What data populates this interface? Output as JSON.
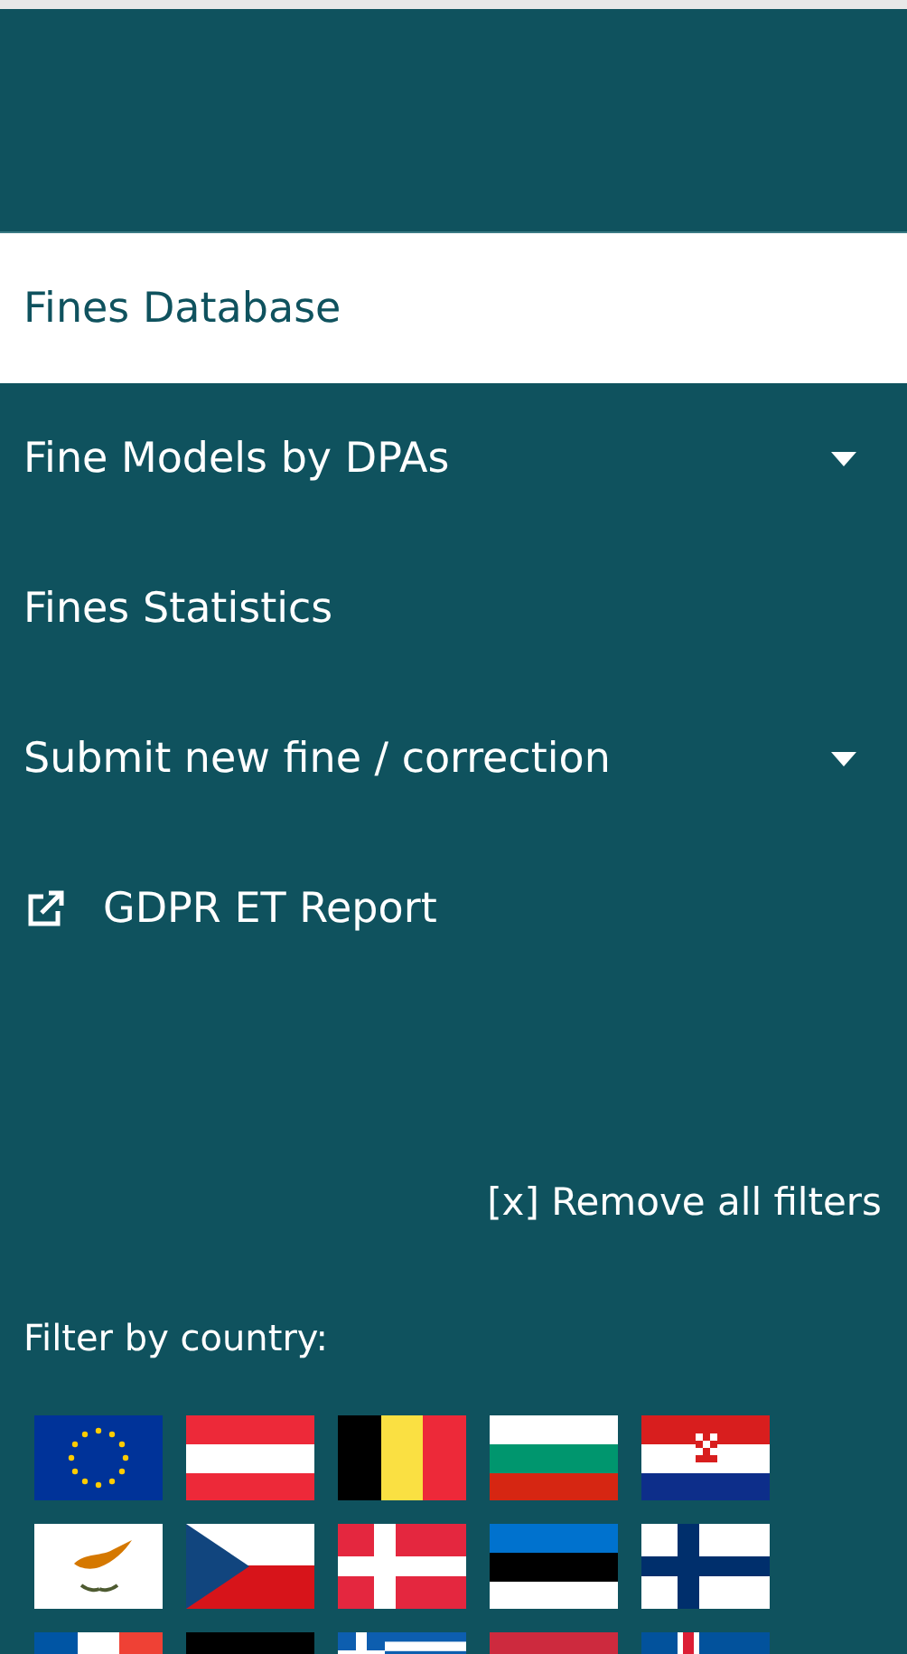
{
  "menu": [
    {
      "label": "Fines Database",
      "selected": true,
      "expandable": false,
      "external": false
    },
    {
      "label": "Fine Models by DPAs",
      "selected": false,
      "expandable": true,
      "external": false
    },
    {
      "label": "Fines Statistics",
      "selected": false,
      "expandable": false,
      "external": false
    },
    {
      "label": "Submit new fine / correction",
      "selected": false,
      "expandable": true,
      "external": false
    },
    {
      "label": "GDPR ET Report",
      "selected": false,
      "expandable": false,
      "external": true
    }
  ],
  "remove_filters": "[x] Remove all filters",
  "country_filter": {
    "label": "Filter by country:",
    "flags": [
      {
        "kind": "eu"
      },
      {
        "kind": "at"
      },
      {
        "kind": "be"
      },
      {
        "kind": "bg"
      },
      {
        "kind": "hr"
      },
      {
        "kind": "cy"
      },
      {
        "kind": "cz"
      },
      {
        "kind": "dk"
      },
      {
        "kind": "ee"
      },
      {
        "kind": "fi"
      },
      {
        "kind": "fr"
      },
      {
        "kind": "de"
      },
      {
        "kind": "gr"
      },
      {
        "kind": "hu"
      },
      {
        "kind": "is"
      }
    ]
  }
}
